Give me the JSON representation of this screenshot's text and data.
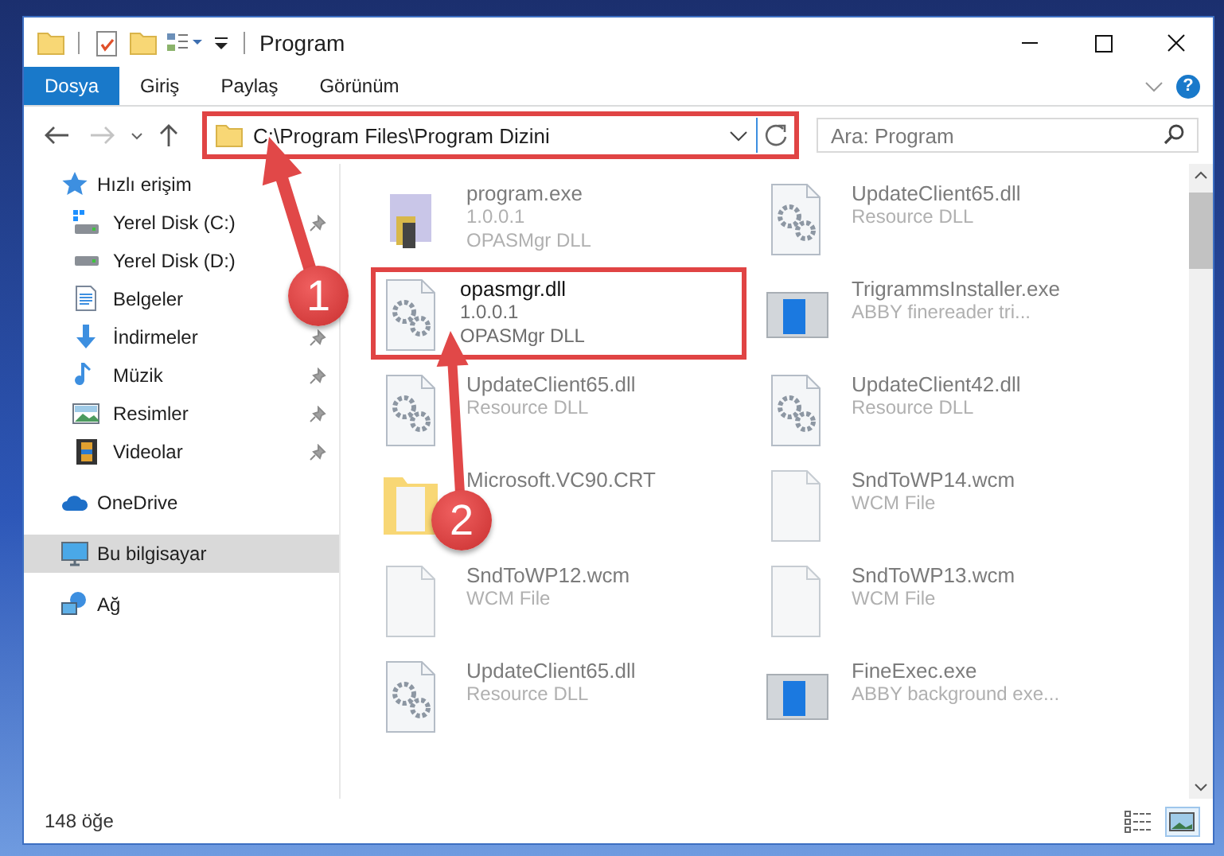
{
  "window": {
    "title": "Program"
  },
  "ribbon": {
    "tabs": [
      {
        "label": "Dosya",
        "selected": true
      },
      {
        "label": "Giriş",
        "selected": false
      },
      {
        "label": "Paylaş",
        "selected": false
      },
      {
        "label": "Görünüm",
        "selected": false
      }
    ],
    "help": "?"
  },
  "address_bar": {
    "path": "C:\\Program Files\\Program Dizini",
    "highlighted": true
  },
  "search": {
    "placeholder": "Ara: Program"
  },
  "sidebar": {
    "items": [
      {
        "label": "Hızlı erişim",
        "kind": "star",
        "selected": false,
        "children": [
          {
            "label": "Yerel Disk (C:)",
            "kind": "drive-win",
            "pinned": true,
            "selected": false
          },
          {
            "label": "Yerel Disk (D:)",
            "kind": "drive",
            "pinned": false,
            "selected": false
          },
          {
            "label": "Belgeler",
            "kind": "document",
            "pinned": false,
            "selected": false
          },
          {
            "label": "İndirmeler",
            "kind": "download",
            "pinned": true,
            "selected": false
          },
          {
            "label": "Müzik",
            "kind": "music",
            "pinned": true,
            "selected": false
          },
          {
            "label": "Resimler",
            "kind": "pictures",
            "pinned": true,
            "selected": false
          },
          {
            "label": "Videolar",
            "kind": "video",
            "pinned": true,
            "selected": false
          }
        ]
      },
      {
        "label": "OneDrive",
        "kind": "cloud",
        "selected": false
      },
      {
        "label": "Bu bilgisayar",
        "kind": "computer",
        "selected": true
      },
      {
        "label": "Ağ",
        "kind": "network",
        "selected": false
      }
    ]
  },
  "files": [
    {
      "name": "program.exe",
      "kind": "installer",
      "details": [
        "1.0.0.1",
        "OPASMgr DLL"
      ],
      "highlighted": false
    },
    {
      "name": "UpdateClient65.dll",
      "kind": "dll",
      "details": [
        "Resource DLL"
      ],
      "highlighted": false
    },
    {
      "name": "opasmgr.dll",
      "kind": "dll",
      "details": [
        "1.0.0.1",
        "OPASMgr DLL"
      ],
      "highlighted": true
    },
    {
      "name": "TrigrammsInstaller.exe",
      "kind": "app",
      "details": [
        "ABBY finereader tri..."
      ],
      "highlighted": false
    },
    {
      "name": "UpdateClient65.dll",
      "kind": "dll",
      "details": [
        "Resource DLL"
      ],
      "highlighted": false
    },
    {
      "name": "UpdateClient42.dll",
      "kind": "dll",
      "details": [
        "Resource DLL"
      ],
      "highlighted": false
    },
    {
      "name": "Microsoft.VC90.CRT",
      "kind": "folder",
      "highlighted": false
    },
    {
      "name": "SndToWP14.wcm",
      "kind": "file",
      "details": [
        "WCM File"
      ],
      "highlighted": false
    },
    {
      "name": "SndToWP12.wcm",
      "kind": "file",
      "details": [
        "WCM File"
      ],
      "highlighted": false
    },
    {
      "name": "SndToWP13.wcm",
      "kind": "file",
      "details": [
        "WCM File"
      ],
      "highlighted": false
    },
    {
      "name": "UpdateClient65.dll",
      "kind": "dll",
      "details": [
        "Resource DLL"
      ],
      "highlighted": false
    },
    {
      "name": "FineExec.exe",
      "kind": "app",
      "details": [
        "ABBY background exe..."
      ],
      "highlighted": false
    }
  ],
  "status_bar": {
    "count": "148 öğe",
    "views": [
      {
        "kind": "details",
        "selected": false
      },
      {
        "kind": "large-icons",
        "selected": true
      }
    ]
  },
  "annotations": [
    {
      "label": "1"
    },
    {
      "label": "2"
    }
  ]
}
